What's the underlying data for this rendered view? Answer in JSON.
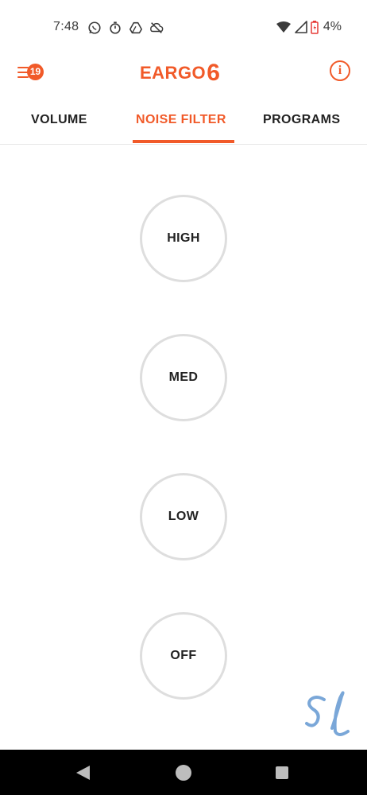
{
  "status_bar": {
    "time": "7:48",
    "battery_percent": "4%",
    "icons": [
      "whatsapp-icon",
      "timer-icon",
      "drive-icon",
      "cloud-off-icon",
      "wifi-icon",
      "cell-signal-icon",
      "battery-low-icon"
    ]
  },
  "header": {
    "menu_badge": "19",
    "brand_name": "EARGO",
    "brand_number": "6",
    "info_icon_glyph": "i"
  },
  "tabs": [
    {
      "label": "VOLUME",
      "active": false
    },
    {
      "label": "NOISE FILTER",
      "active": true
    },
    {
      "label": "PROGRAMS",
      "active": false
    }
  ],
  "filter_options": [
    {
      "label": "HIGH"
    },
    {
      "label": "MED"
    },
    {
      "label": "LOW"
    },
    {
      "label": "OFF"
    }
  ],
  "colors": {
    "accent": "#f15a29",
    "text": "#222222",
    "circle_border": "#dedede",
    "nav_bar": "#000000",
    "watermark": "#7aa7d8"
  },
  "nav_bar": {
    "icons": [
      "back-icon",
      "home-icon",
      "recents-icon"
    ]
  }
}
